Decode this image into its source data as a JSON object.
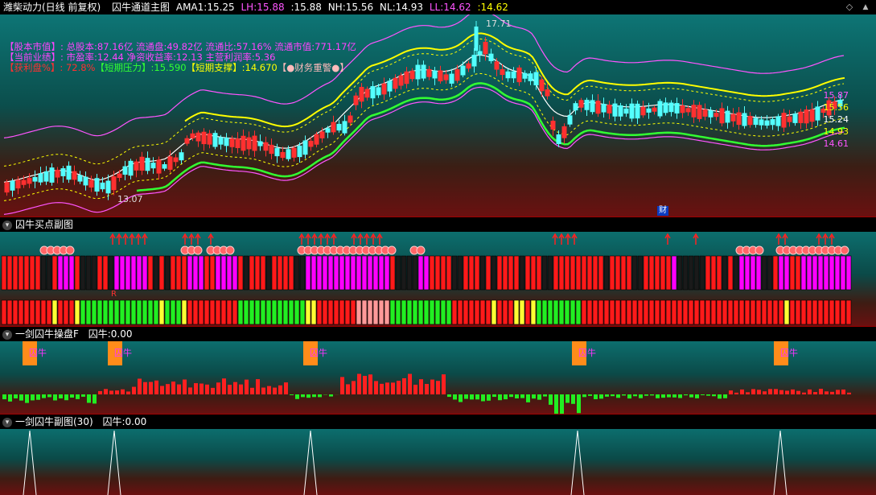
{
  "main": {
    "stock_title": "潍柴动力(日线 前复权)",
    "indicator_name": "囚牛通道主图",
    "ama1": {
      "label": "AMA1:",
      "value": "15.25",
      "color": "#ffffff"
    },
    "lh": {
      "label": "LH:",
      "value": "15.88",
      "color": "#ff55ff"
    },
    "sep_val": {
      "label": ":",
      "value": "15.88",
      "color": "#ffffff"
    },
    "nh": {
      "label": "NH:",
      "value": "15.56",
      "color": "#ffffff"
    },
    "nl": {
      "label": "NL:",
      "value": "14.93",
      "color": "#ffffff"
    },
    "ll": {
      "label": "LL:",
      "value": "14.62",
      "color": "#ff55ff"
    },
    "ll2": {
      "label": ":",
      "value": "14.62",
      "color": "#ffff00"
    },
    "info_line1": "【股本市值】: 总股本:87.16亿 流通盘:49.82亿 流通比:57.16% 流通市值:771.17亿",
    "info_line2": "【当前业绩】: 市盈率:12.44 净资收益率:12.13 主营利润率:5.36",
    "info_line3_a": "【获利盘%】: 72.8%",
    "info_line3_b": "【短期压力】:15.590",
    "info_line3_c": "【短期支撑】:14.670",
    "info_line3_d": "【●财务重警●】",
    "high_label": "17.71",
    "low_label": "13.07",
    "cai_badge": "财",
    "right_labels": [
      {
        "text": "15.87",
        "color": "#ff55ff"
      },
      {
        "text": "15.56",
        "color": "#ffff00"
      },
      {
        "text": "15.24",
        "color": "#ffffff"
      },
      {
        "text": "14.93",
        "color": "#ffff00"
      },
      {
        "text": "14.61",
        "color": "#ff55ff"
      }
    ]
  },
  "panel2": {
    "title": "囚牛买点副图",
    "marker": "R"
  },
  "panel3": {
    "title": "一剑囚牛操盘F",
    "field": "囚牛:",
    "value": "0.00",
    "badge": "囚牛"
  },
  "panel4": {
    "title": "一剑囚牛副图(30)",
    "field": "囚牛:",
    "value": "0.00"
  },
  "controls": {
    "diamond": "◇",
    "up": "▲"
  },
  "colors": {
    "up": "#ff3030",
    "down": "#54ffff",
    "upper_band": "#ff55ff",
    "lower_band": "#32ff32",
    "mid": "#ffffff",
    "dash": "#ffff00"
  }
}
